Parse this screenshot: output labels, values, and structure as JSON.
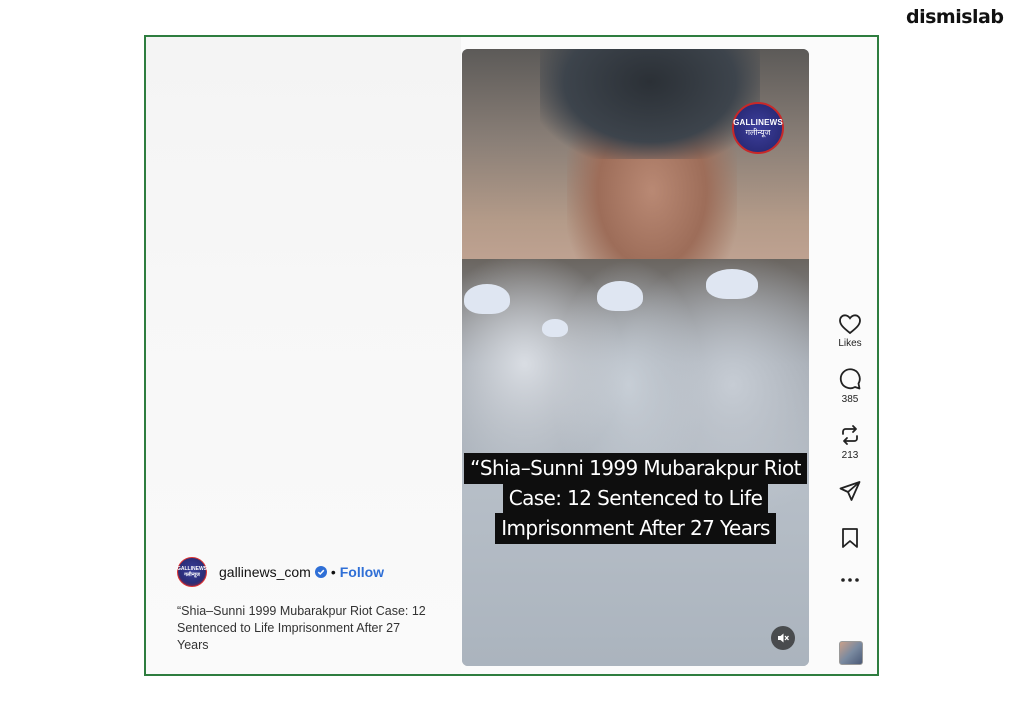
{
  "brand": "dismislab",
  "post": {
    "username": "gallinews_com",
    "separator": "•",
    "follow_label": "Follow",
    "caption": "“Shia–Sunni 1999 Mubarakpur Riot Case: 12 Sentenced to Life Imprisonment After 27 Years",
    "avatar_text_1": "GALLINEWS",
    "avatar_text_2": "गलीन्यूज"
  },
  "video": {
    "channel_logo_line1": "GALLINEWS",
    "channel_logo_line2": "गलीन्यूज",
    "overlay_lines": [
      "“Shia–Sunni 1999 Mubarakpur Riot",
      "Case: 12 Sentenced to Life",
      "Imprisonment After 27 Years"
    ],
    "mute_icon": "muted-speaker-icon"
  },
  "actions": {
    "likes_label": "Likes",
    "comments_count": "385",
    "reposts_count": "213",
    "icons": [
      "heart-icon",
      "comment-icon",
      "repost-icon",
      "share-icon",
      "bookmark-icon",
      "more-icon"
    ]
  },
  "colors": {
    "frame_border": "#2e7d3f",
    "follow": "#2f6fd6",
    "verified": "#2f6fd6"
  }
}
